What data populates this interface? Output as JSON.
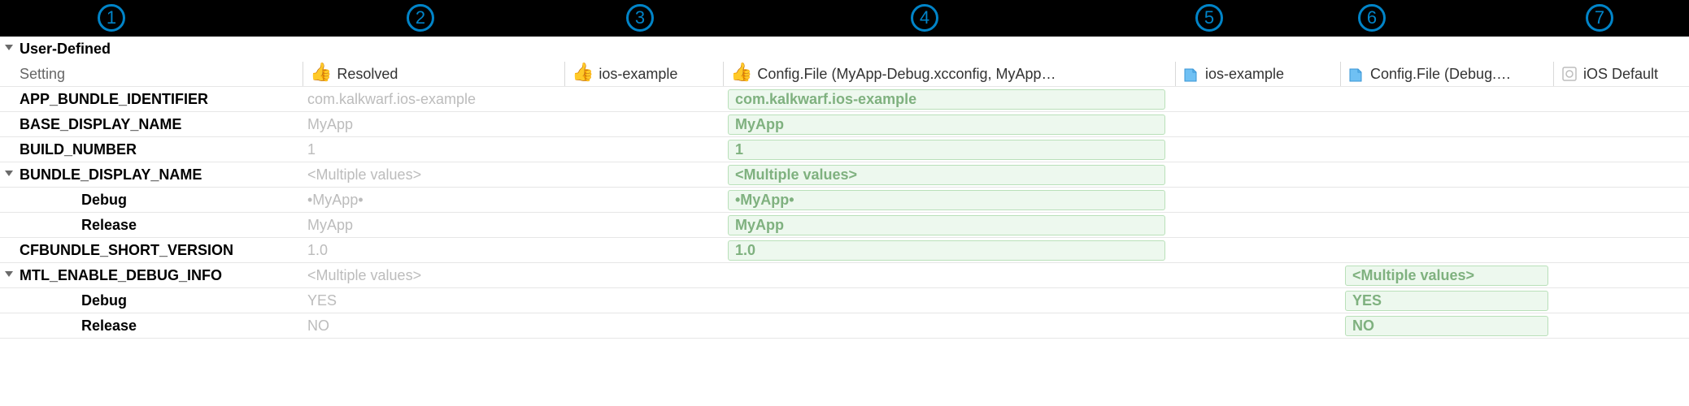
{
  "badges": [
    "1",
    "2",
    "3",
    "4",
    "5",
    "6",
    "7"
  ],
  "badge_positions": [
    120,
    500,
    770,
    1120,
    1470,
    1670,
    1950
  ],
  "section_title": "User-Defined",
  "columns": {
    "setting": "Setting",
    "resolved": "Resolved",
    "target": "ios-example",
    "config_file_target": "Config.File (MyApp-Debug.xcconfig, MyApp…",
    "project": "ios-example",
    "config_file_project": "Config.File (Debug.…",
    "default": "iOS Default"
  },
  "rows": [
    {
      "name": "APP_BUNDLE_IDENTIFIER",
      "resolved": "com.kalkwarf.ios-example",
      "col4": "com.kalkwarf.ios-example",
      "green4": true
    },
    {
      "name": "BASE_DISPLAY_NAME",
      "resolved": "MyApp",
      "col4": "MyApp",
      "green4": true
    },
    {
      "name": "BUILD_NUMBER",
      "resolved": "1",
      "col4": "1",
      "green4": true
    },
    {
      "name": "BUNDLE_DISPLAY_NAME",
      "resolved": "<Multiple values>",
      "col4": "<Multiple values>",
      "green4": true,
      "expandable": true,
      "children": [
        {
          "name": "Debug",
          "resolved": "•MyApp•",
          "col4": "•MyApp•",
          "green4": true
        },
        {
          "name": "Release",
          "resolved": "MyApp",
          "col4": "MyApp",
          "green4": true
        }
      ]
    },
    {
      "name": "CFBUNDLE_SHORT_VERSION",
      "resolved": "1.0",
      "col4": "1.0",
      "green4": true
    },
    {
      "name": "MTL_ENABLE_DEBUG_INFO",
      "resolved": "<Multiple values>",
      "col6": "<Multiple values>",
      "green6": true,
      "expandable": true,
      "children": [
        {
          "name": "Debug",
          "resolved": "YES",
          "col6": "YES",
          "green6": true
        },
        {
          "name": "Release",
          "resolved": "NO",
          "col6": "NO",
          "green6": true
        }
      ]
    }
  ]
}
